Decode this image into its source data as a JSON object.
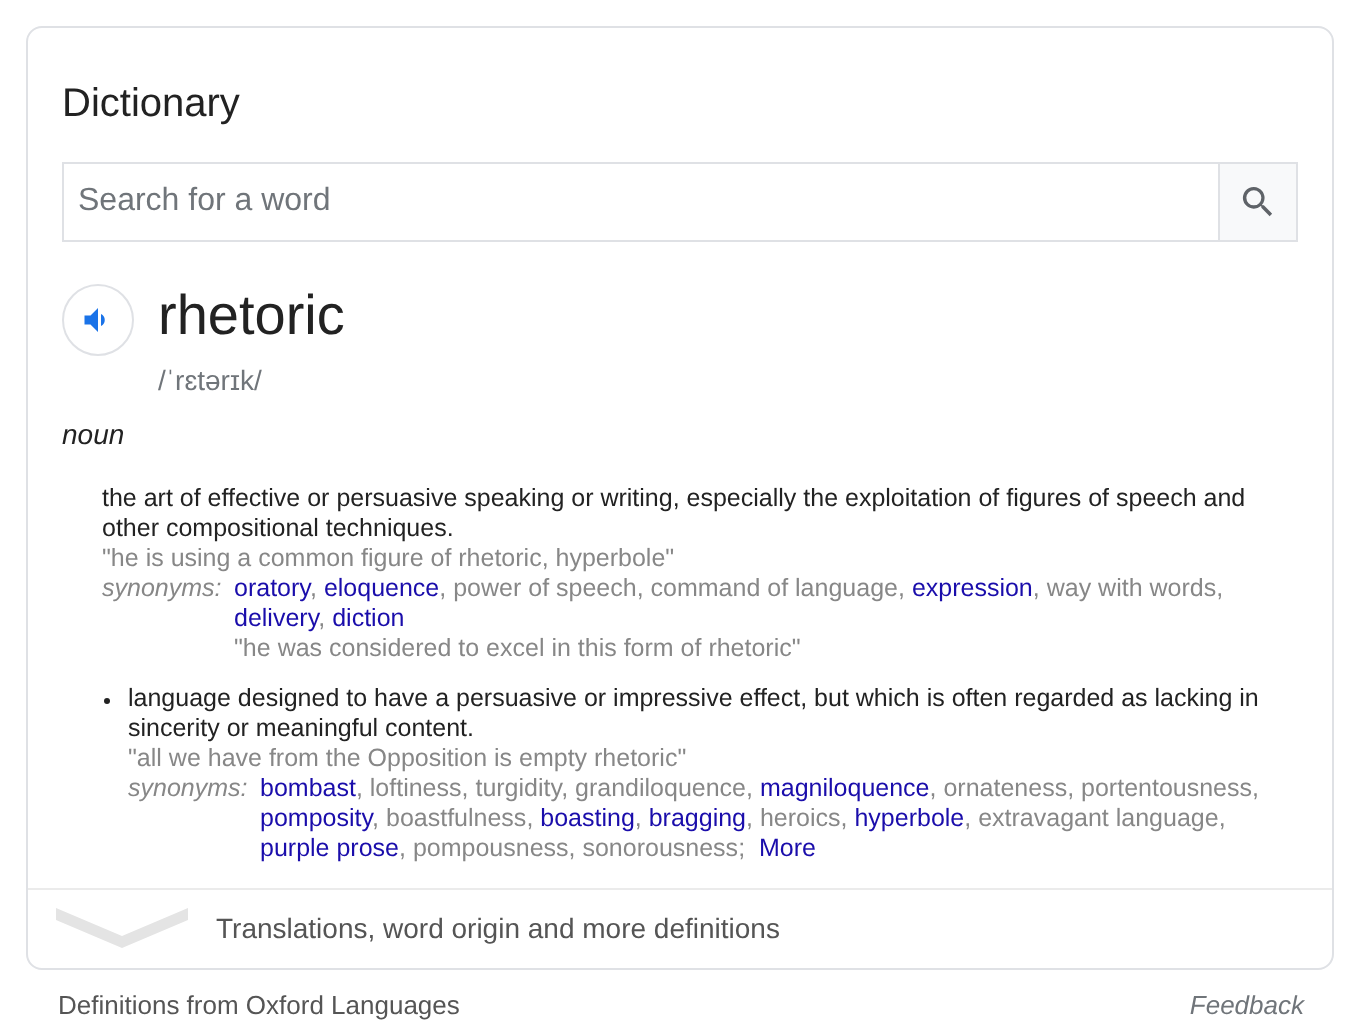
{
  "card": {
    "title": "Dictionary",
    "search": {
      "placeholder": "Search for a word"
    },
    "entry": {
      "word": "rhetoric",
      "phonetic": "/ˈrɛtərɪk/",
      "part_of_speech": "noun",
      "senses": [
        {
          "bulleted": false,
          "definition": "the art of effective or persuasive speaking or writing, especially the exploitation of figures of speech and other compositional techniques.",
          "example": "\"he is using a common figure of rhetoric, hyperbole\"",
          "synonyms_label": "synonyms:",
          "synonyms": [
            {
              "text": "oratory",
              "kind": "link"
            },
            {
              "text": "eloquence",
              "kind": "link"
            },
            {
              "text": "power of speech",
              "kind": "plain"
            },
            {
              "text": "command of language",
              "kind": "plain"
            },
            {
              "text": "expression",
              "kind": "link"
            },
            {
              "text": "way with words",
              "kind": "plain"
            },
            {
              "text": "delivery",
              "kind": "link"
            },
            {
              "text": "diction",
              "kind": "link"
            }
          ],
          "separator": ",",
          "synonym_example": "\"he was considered to excel in this form of rhetoric\""
        },
        {
          "bulleted": true,
          "definition": "language designed to have a persuasive or impressive effect, but which is often regarded as lacking in sincerity or meaningful content.",
          "example": "\"all we have from the Opposition is empty rhetoric\"",
          "synonyms_label": "synonyms:",
          "synonyms": [
            {
              "text": "bombast",
              "kind": "link"
            },
            {
              "text": "loftiness",
              "kind": "plain"
            },
            {
              "text": "turgidity",
              "kind": "plain"
            },
            {
              "text": "grandiloquence",
              "kind": "plain"
            },
            {
              "text": "magniloquence",
              "kind": "link"
            },
            {
              "text": "ornateness",
              "kind": "plain"
            },
            {
              "text": "portentousness",
              "kind": "plain"
            },
            {
              "text": "pomposity",
              "kind": "link"
            },
            {
              "text": "boastfulness",
              "kind": "plain"
            },
            {
              "text": "boasting",
              "kind": "link"
            },
            {
              "text": "bragging",
              "kind": "link"
            },
            {
              "text": "heroics",
              "kind": "plain"
            },
            {
              "text": "hyperbole",
              "kind": "link"
            },
            {
              "text": "extravagant language",
              "kind": "plain"
            },
            {
              "text": "purple prose",
              "kind": "link"
            },
            {
              "text": "pompousness",
              "kind": "plain"
            },
            {
              "text": "sonorousness",
              "kind": "plain"
            }
          ],
          "separator": ",",
          "more_separator": ";",
          "more": "More"
        }
      ]
    },
    "expand_label": "Translations, word origin and more definitions"
  },
  "footer": {
    "source": "Definitions from Oxford Languages",
    "feedback": "Feedback"
  }
}
